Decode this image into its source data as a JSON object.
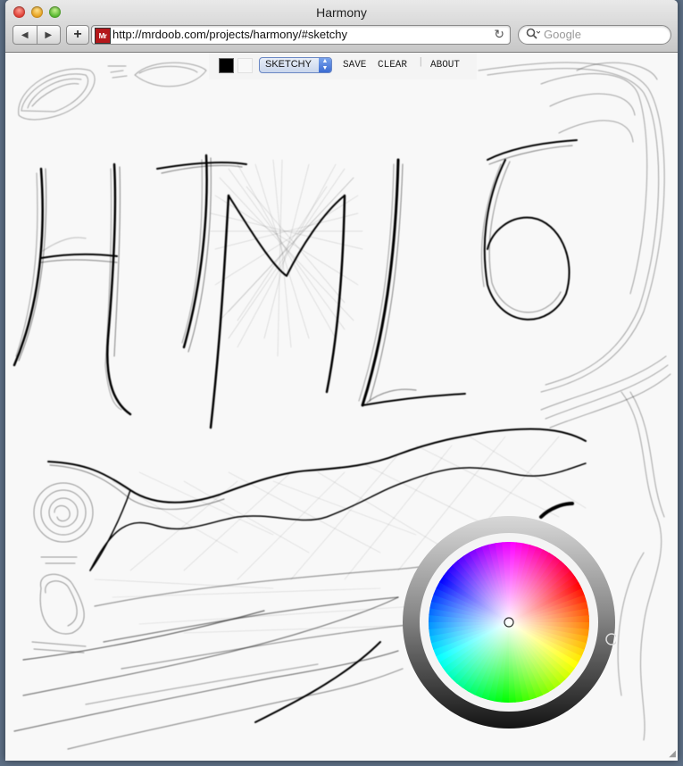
{
  "window": {
    "title": "Harmony"
  },
  "nav": {
    "back_glyph": "◀",
    "forward_glyph": "▶",
    "add_glyph": "+"
  },
  "addressbar": {
    "favicon_text": "Mr",
    "url": "http://mrdoob.com/projects/harmony/#sketchy",
    "reload_glyph": "↻"
  },
  "search": {
    "icon_glyph": "🔍",
    "placeholder": "Google"
  },
  "toolbar": {
    "foreground_color": "#000000",
    "background_color": "#f8f8f8",
    "brush": "SKETCHY",
    "save_label": "SAVE",
    "clear_label": "CLEAR",
    "separator": "|",
    "about_label": "ABOUT"
  },
  "drawing": {
    "text": "HTML5"
  },
  "icons": [
    "back-arrow-icon",
    "forward-arrow-icon",
    "add-icon",
    "reload-icon",
    "search-icon",
    "resize-grip-icon"
  ]
}
